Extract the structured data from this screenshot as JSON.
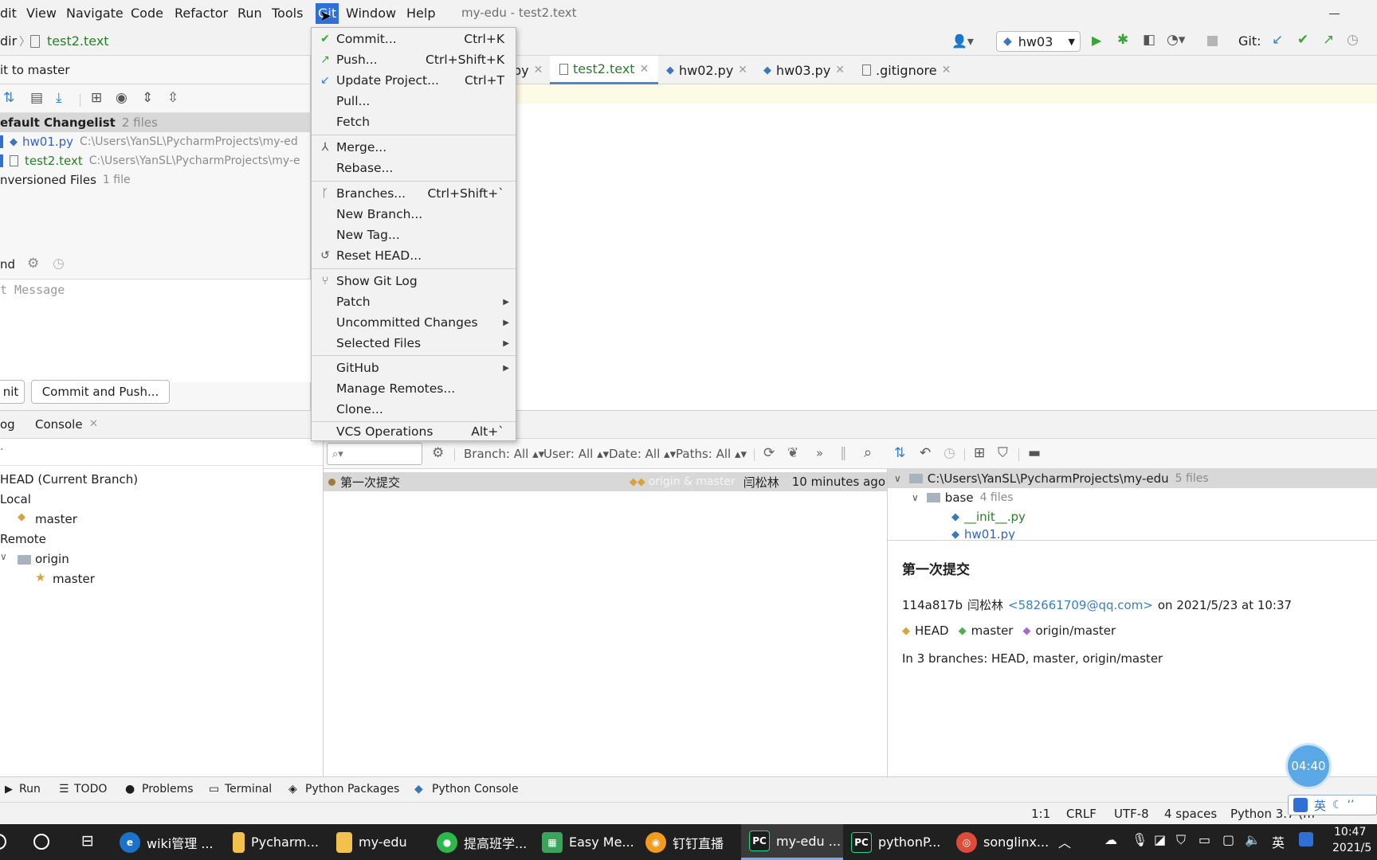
{
  "menubar": {
    "items": [
      "dit",
      "View",
      "Navigate",
      "Code",
      "Refactor",
      "Run",
      "Tools",
      "Git",
      "Window",
      "Help"
    ],
    "title": "my-edu - test2.text"
  },
  "navbar": {
    "crumb_dir": "dir",
    "crumb_file": "test2.text",
    "run_config": "hw03",
    "git_label": "Git:"
  },
  "commit_panel": {
    "title": "it to master",
    "changelist_name": "efault Changelist",
    "changelist_count": "2 files",
    "files": [
      {
        "name": "hw01.py",
        "path": "C:\\Users\\YanSL\\PycharmProjects\\my-ed"
      },
      {
        "name": "test2.text",
        "path": "C:\\Users\\YanSL\\PycharmProjects\\my-e"
      }
    ],
    "unversioned_label": "nversioned Files",
    "unversioned_count": "1 file",
    "amend_label": "nd",
    "message_placeholder": "t Message",
    "commit_button": "nit",
    "commit_push_button": "Commit and Push..."
  },
  "editor": {
    "tabs": [
      {
        "label": "py",
        "active": false
      },
      {
        "label": "test2.text",
        "active": true
      },
      {
        "label": "hw02.py",
        "active": false
      },
      {
        "label": "hw03.py",
        "active": false
      },
      {
        "label": ".gitignore",
        "active": false
      }
    ]
  },
  "git_menu": {
    "items": [
      {
        "label": "Commit...",
        "shortcut": "Ctrl+K",
        "icon": "check"
      },
      {
        "label": "Push...",
        "shortcut": "Ctrl+Shift+K",
        "icon": "push"
      },
      {
        "label": "Update Project...",
        "shortcut": "Ctrl+T",
        "icon": "update"
      },
      {
        "label": "Pull...",
        "shortcut": ""
      },
      {
        "label": "Fetch",
        "shortcut": ""
      },
      {
        "label": "Merge...",
        "shortcut": "",
        "icon": "merge"
      },
      {
        "label": "Rebase...",
        "shortcut": ""
      },
      {
        "label": "Branches...",
        "shortcut": "Ctrl+Shift+`",
        "icon": "branch"
      },
      {
        "label": "New Branch...",
        "shortcut": ""
      },
      {
        "label": "New Tag...",
        "shortcut": ""
      },
      {
        "label": "Reset HEAD...",
        "shortcut": "",
        "icon": "reset"
      },
      {
        "label": "Show Git Log",
        "shortcut": "",
        "icon": "log"
      },
      {
        "label": "Patch",
        "shortcut": "",
        "submenu": true
      },
      {
        "label": "Uncommitted Changes",
        "shortcut": "",
        "submenu": true
      },
      {
        "label": "Selected Files",
        "shortcut": "",
        "submenu": true
      },
      {
        "label": "GitHub",
        "shortcut": "",
        "submenu": true
      },
      {
        "label": "Manage Remotes...",
        "shortcut": ""
      },
      {
        "label": "Clone...",
        "shortcut": ""
      },
      {
        "label": "VCS Operations",
        "shortcut": "Alt+`"
      }
    ]
  },
  "log_panel": {
    "tabs": [
      "og",
      "Console"
    ],
    "branches": {
      "head": "HEAD (Current Branch)",
      "local": "Local",
      "local_master": "master",
      "remote": "Remote",
      "origin": "origin",
      "origin_master": "master"
    },
    "filters": {
      "branch": "Branch: All",
      "user": "User: All",
      "date": "Date: All",
      "paths": "Paths: All"
    },
    "commits": [
      {
        "message": "第一次提交",
        "refs": "origin & master",
        "author": "闫松林",
        "time": "10 minutes ago"
      }
    ],
    "tree": {
      "root": "C:\\Users\\YanSL\\PycharmProjects\\my-edu",
      "root_count": "5 files",
      "folder": "base",
      "folder_count": "4 files",
      "file1": "__init__.py",
      "file2": "hw01.py"
    },
    "details": {
      "title": "第一次提交",
      "hash": "114a817b",
      "author": "闫松林",
      "email": "<582661709@qq.com>",
      "date": "on 2021/5/23 at 10:37",
      "ref_head": "HEAD",
      "ref_master": "master",
      "ref_origin": "origin/master",
      "branches_line": "In 3 branches: HEAD, master, origin/master"
    }
  },
  "tool_strip": [
    "Run",
    "TODO",
    "Problems",
    "Terminal",
    "Python Packages",
    "Python Console"
  ],
  "status_bar": {
    "position": "1:1",
    "line_sep": "CRLF",
    "encoding": "UTF-8",
    "indent": "4 spaces",
    "interpreter": "Python 3.7 (m"
  },
  "timer": "04:40",
  "ime": {
    "lang": "英"
  },
  "taskbar": {
    "items": [
      {
        "label": "wiki管理 ...",
        "color": "#1a73c8"
      },
      {
        "label": "Pycharm...",
        "color": "#f2c14e"
      },
      {
        "label": "my-edu",
        "color": "#f2c14e"
      },
      {
        "label": "提高班学...",
        "color": "#2db84d"
      },
      {
        "label": "Easy Me...",
        "color": "#3aa55a"
      },
      {
        "label": "钉钉直播",
        "color": "#f29b1d"
      },
      {
        "label": "my-edu ...",
        "color": "#1d1d1d",
        "active": true
      },
      {
        "label": "pythonP...",
        "color": "#1d1d1d"
      },
      {
        "label": "songlinx...",
        "color": "#dd4b39"
      }
    ],
    "clock_time": "10:47",
    "clock_date": "2021/5",
    "tray_lang": "英"
  }
}
